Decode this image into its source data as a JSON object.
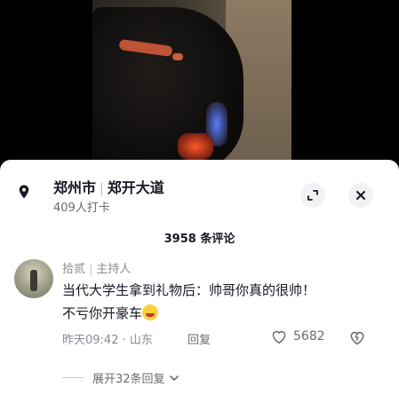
{
  "location": {
    "city": "郑州市",
    "road": "郑开大道",
    "checkins": "409人打卡",
    "icon": "location-pin-icon"
  },
  "comments_header": {
    "count_label": "3958 条评论"
  },
  "comment": {
    "author": "拾贰",
    "author_role": "主持人",
    "text_line1": "当代大学生拿到礼物后：帅哥你真的很帅！",
    "text_line2": "不亏你开豪车",
    "time": "昨天09:42",
    "region": "山东",
    "reply_label": "回复",
    "likes": "5682"
  },
  "more_replies": {
    "label": "展开32条回复"
  },
  "colors": {
    "text_primary": "#161823",
    "text_secondary": "#8a8b91",
    "button_bg": "#f2f2f4"
  }
}
